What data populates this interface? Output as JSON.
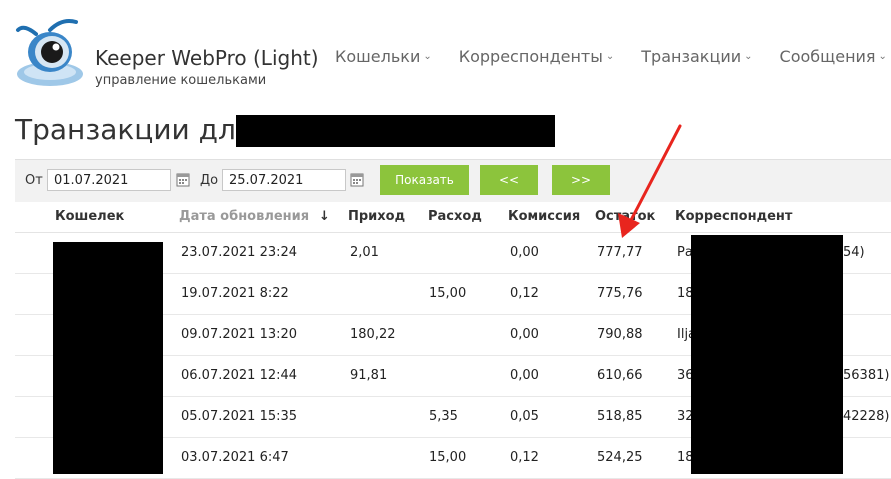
{
  "brand": {
    "title": "Keeper WebPro (Light)",
    "subtitle": "управление кошельками"
  },
  "nav": [
    {
      "label": "Кошельки"
    },
    {
      "label": "Корреспонденты"
    },
    {
      "label": "Транзакции"
    },
    {
      "label": "Сообщения"
    }
  ],
  "page_title": "Транзакции для",
  "filter": {
    "from_label": "От",
    "from_value": "01.07.2021",
    "to_label": "До",
    "to_value": "25.07.2021",
    "show_button": "Показать",
    "prev_button": "<<",
    "next_button": ">>"
  },
  "columns": {
    "wallet": "Кошелек",
    "updated": "Дата обновления",
    "sort_indicator": "↓",
    "income": "Приход",
    "expense": "Расход",
    "fee": "Комиссия",
    "balance": "Остаток",
    "correspondent": "Корреспондент"
  },
  "rows": [
    {
      "date": "23.07.2021 23:24",
      "income": "2,01",
      "expense": "",
      "fee": "0,00",
      "balance": "777,77",
      "corr_start": "Ра",
      "corr_end": "54)"
    },
    {
      "date": "19.07.2021 8:22",
      "income": "",
      "expense": "15,00",
      "fee": "0,12",
      "balance": "775,76",
      "corr_start": "18",
      "corr_end": ""
    },
    {
      "date": "09.07.2021 13:20",
      "income": "180,22",
      "expense": "",
      "fee": "0,00",
      "balance": "790,88",
      "corr_start": "Ilja",
      "corr_end": ""
    },
    {
      "date": "06.07.2021 12:44",
      "income": "91,81",
      "expense": "",
      "fee": "0,00",
      "balance": "610,66",
      "corr_start": "36",
      "corr_end": "56381)"
    },
    {
      "date": "05.07.2021 15:35",
      "income": "",
      "expense": "5,35",
      "fee": "0,05",
      "balance": "518,85",
      "corr_start": "32",
      "corr_end": "42228)"
    },
    {
      "date": "03.07.2021 6:47",
      "income": "",
      "expense": "15,00",
      "fee": "0,12",
      "balance": "524,25",
      "corr_start": "18",
      "corr_end": ""
    }
  ],
  "colors": {
    "accent_green": "#8cc43c",
    "annotation_red": "#e8251e"
  }
}
